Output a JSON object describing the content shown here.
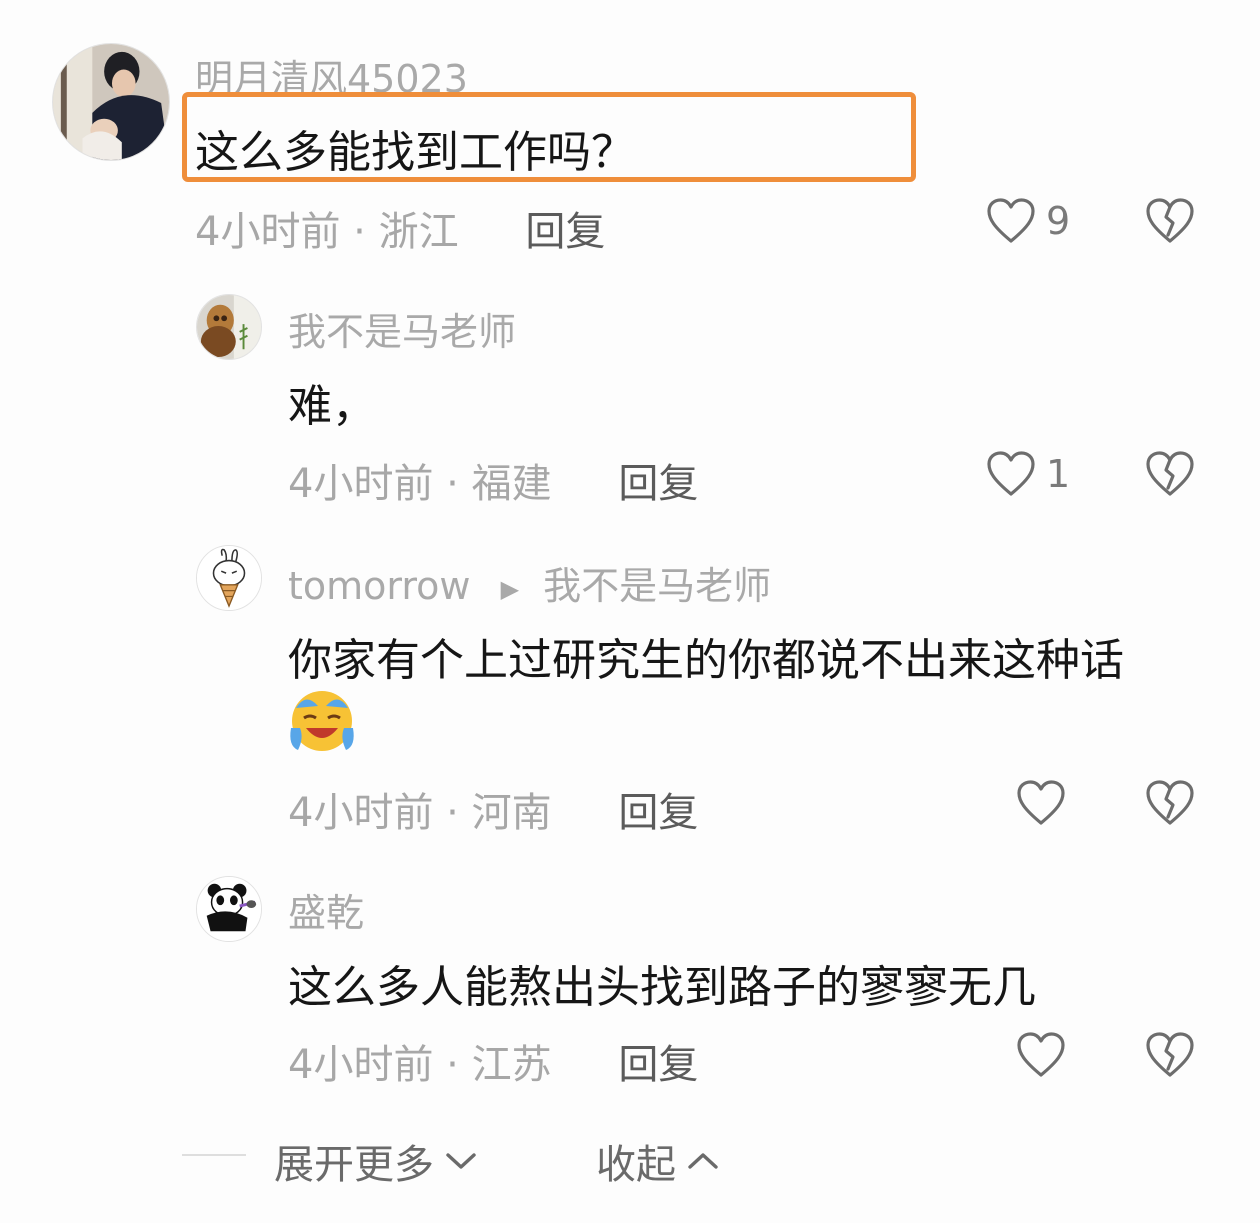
{
  "comments": [
    {
      "username": "明月清风45023",
      "text": "这么多能找到工作吗？",
      "time": "4小时前",
      "location": "浙江",
      "reply_label": "回复",
      "likes": "9",
      "avatar_icon": "user-photo-avatar"
    },
    {
      "username": "我不是马老师",
      "text": "难，",
      "time": "4小时前",
      "location": "福建",
      "reply_label": "回复",
      "likes": "1",
      "avatar_icon": "figurine-avatar"
    },
    {
      "username": "tomorrow",
      "reply_to": "我不是马老师",
      "text": "你家有个上过研究生的你都说不出来这种话",
      "emoji": "crying-laughing-emoji",
      "time": "4小时前",
      "location": "河南",
      "reply_label": "回复",
      "likes": "",
      "avatar_icon": "rabbit-cartoon-avatar"
    },
    {
      "username": "盛乾",
      "text": "这么多人能熬出头找到路子的寥寥无几",
      "time": "4小时前",
      "location": "江苏",
      "reply_label": "回复",
      "likes": "",
      "avatar_icon": "panda-meme-avatar"
    }
  ],
  "footer": {
    "expand_label": "展开更多",
    "collapse_label": "收起"
  },
  "colors": {
    "highlight": "#ef8e3b",
    "name": "#a9a9a9",
    "text": "#161616",
    "meta": "#a7a7a7"
  }
}
